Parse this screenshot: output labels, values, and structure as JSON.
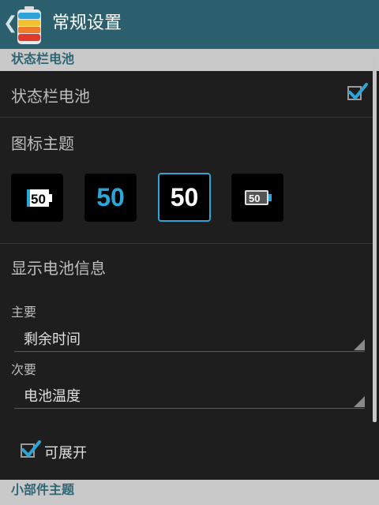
{
  "header": {
    "back_icon": "chevron-left-icon",
    "app_icon": "battery-app-icon",
    "title": "常规设置"
  },
  "sections": {
    "status_bar_battery": "状态栏电池",
    "widget_theme": "小部件主题"
  },
  "status_bar_battery": {
    "label": "状态栏电池",
    "checked": true
  },
  "icon_theme": {
    "label": "图标主题",
    "tiles": [
      {
        "text": "50",
        "style": "white-battery"
      },
      {
        "text": "50",
        "style": "blue-number"
      },
      {
        "text": "50",
        "style": "white-number-selected"
      },
      {
        "text": "50",
        "style": "battery-outline"
      }
    ],
    "selected_index": 2
  },
  "battery_info": {
    "label": "显示电池信息",
    "primary_label": "主要",
    "primary_value": "剩余时间",
    "secondary_label": "次要",
    "secondary_value": "电池温度",
    "expandable_label": "可展开",
    "expandable_checked": true
  },
  "colors": {
    "titlebar": "#2b5f6d",
    "accent": "#2aa7d6",
    "background": "#1e1e1e",
    "section_bg": "#c9c9c9",
    "section_text": "#2f6574"
  }
}
